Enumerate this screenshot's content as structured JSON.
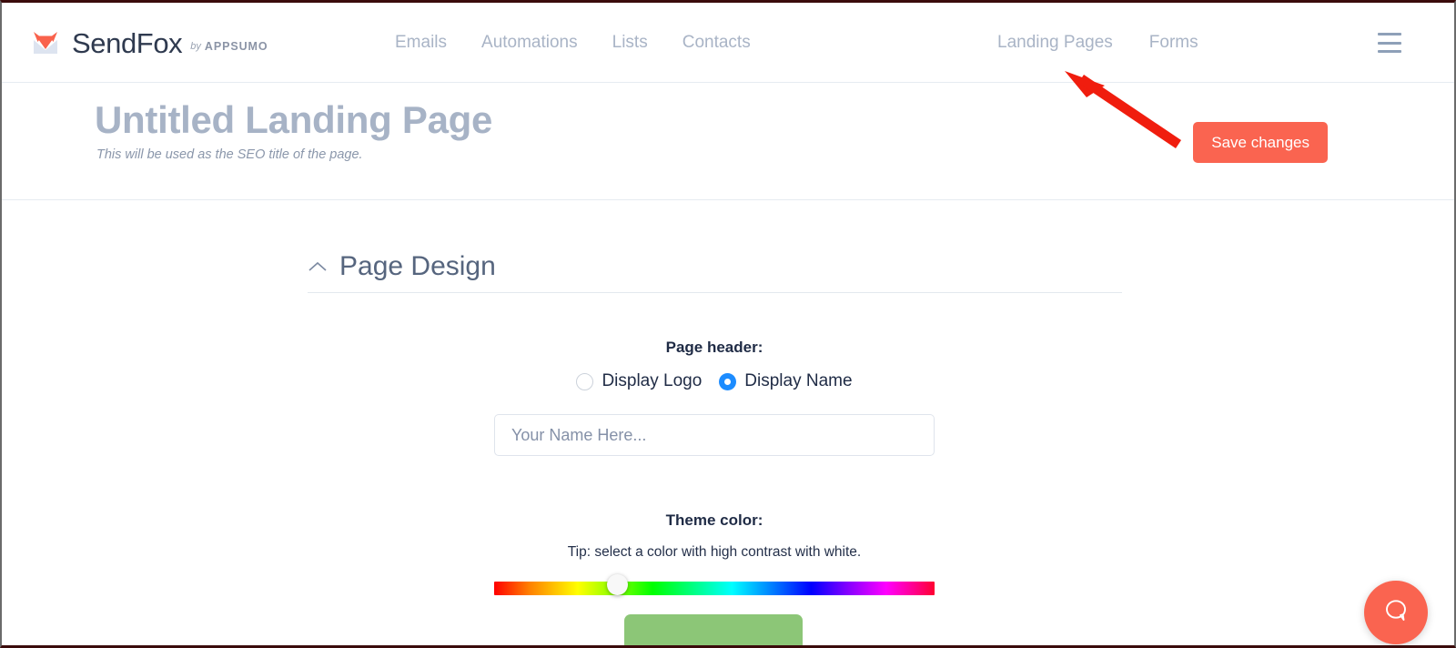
{
  "brand": {
    "name": "SendFox",
    "by": "by",
    "parent": "AppSumo",
    "logo_icon": "fox-envelope-logo",
    "logo_ear_color": "#f9624c",
    "logo_envelope_color": "#dbe3f0"
  },
  "nav": {
    "center_items": [
      {
        "label": "Emails",
        "name": "nav-emails"
      },
      {
        "label": "Automations",
        "name": "nav-automations"
      },
      {
        "label": "Lists",
        "name": "nav-lists"
      },
      {
        "label": "Contacts",
        "name": "nav-contacts"
      }
    ],
    "right_items": [
      {
        "label": "Landing Pages",
        "name": "nav-landing-pages"
      },
      {
        "label": "Forms",
        "name": "nav-forms"
      }
    ],
    "menu_icon": "hamburger-menu-icon",
    "link_color": "#a9b4c6"
  },
  "header": {
    "title": "Untitled Landing Page",
    "subtitle": "This will be used as the SEO title of the page.",
    "save_label": "Save changes",
    "save_color": "#fa6450",
    "title_color": "#a7b3c6"
  },
  "annotation": {
    "type": "arrow",
    "color": "#f01d0e",
    "points_to": "Landing Pages"
  },
  "section": {
    "title": "Page Design",
    "collapse_icon": "chevron-up-icon",
    "title_color": "#56657e"
  },
  "form": {
    "page_header_label": "Page header:",
    "radios": [
      {
        "label": "Display Logo",
        "checked": false,
        "name": "radio-display-logo"
      },
      {
        "label": "Display Name",
        "checked": true,
        "name": "radio-display-name"
      }
    ],
    "radio_checked_color": "#1c8cff",
    "name_placeholder": "Your Name Here...",
    "name_value": "",
    "theme_color_label": "Theme color:",
    "theme_tip": "Tip: select a color with high contrast with white.",
    "hue_slider": {
      "handle_position_percent": 27,
      "selected_hue": "green-yellow"
    },
    "preview_button_color": "#8cc677"
  },
  "chat": {
    "icon": "chat-bubble-icon",
    "color": "#fa6450"
  }
}
